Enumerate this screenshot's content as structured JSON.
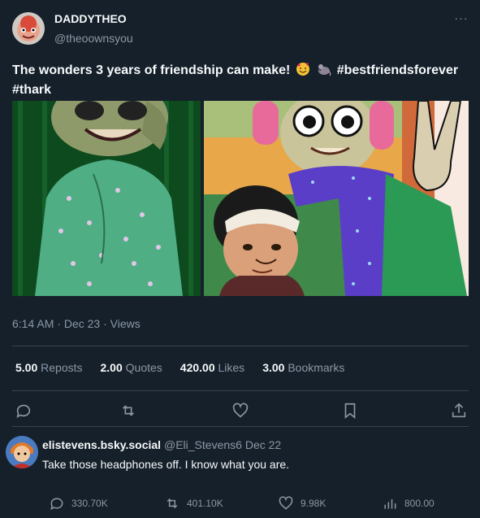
{
  "tweet": {
    "author": {
      "display_name": "DADDYTHEO",
      "handle": "@theoownsyou"
    },
    "more_label": "···",
    "text_line1": "The wonders 3 years of friendship can make!",
    "hashtag1": "#bestfriendsforever",
    "hashtag2": "#thark",
    "emojis": [
      "smiling-face-with-hearts-emoji",
      "rat-emoji"
    ],
    "time": "6:14 AM",
    "date": "Dec 23",
    "views_label": "Views",
    "stats": [
      {
        "value": "5.00",
        "label": "Reposts"
      },
      {
        "value": "2.00",
        "label": "Quotes"
      },
      {
        "value": "420.00",
        "label": "Likes"
      },
      {
        "value": "3.00",
        "label": "Bookmarks"
      }
    ],
    "actions": [
      "reply-icon",
      "repost-icon",
      "like-icon",
      "bookmark-icon",
      "share-icon"
    ]
  },
  "reply": {
    "display_name": "elistevens.bsky.social",
    "handle": "@Eli_Stevens6",
    "date": "Dec 22",
    "text": "Take those headphones off. I know what you are.",
    "counts": {
      "replies": "330.70K",
      "reposts": "401.10K",
      "likes": "9.98K",
      "views": "800.00"
    }
  },
  "colors": {
    "background": "#15202b",
    "text": "#f7f9f9",
    "muted": "#8b98a5",
    "divider": "#38444d"
  }
}
